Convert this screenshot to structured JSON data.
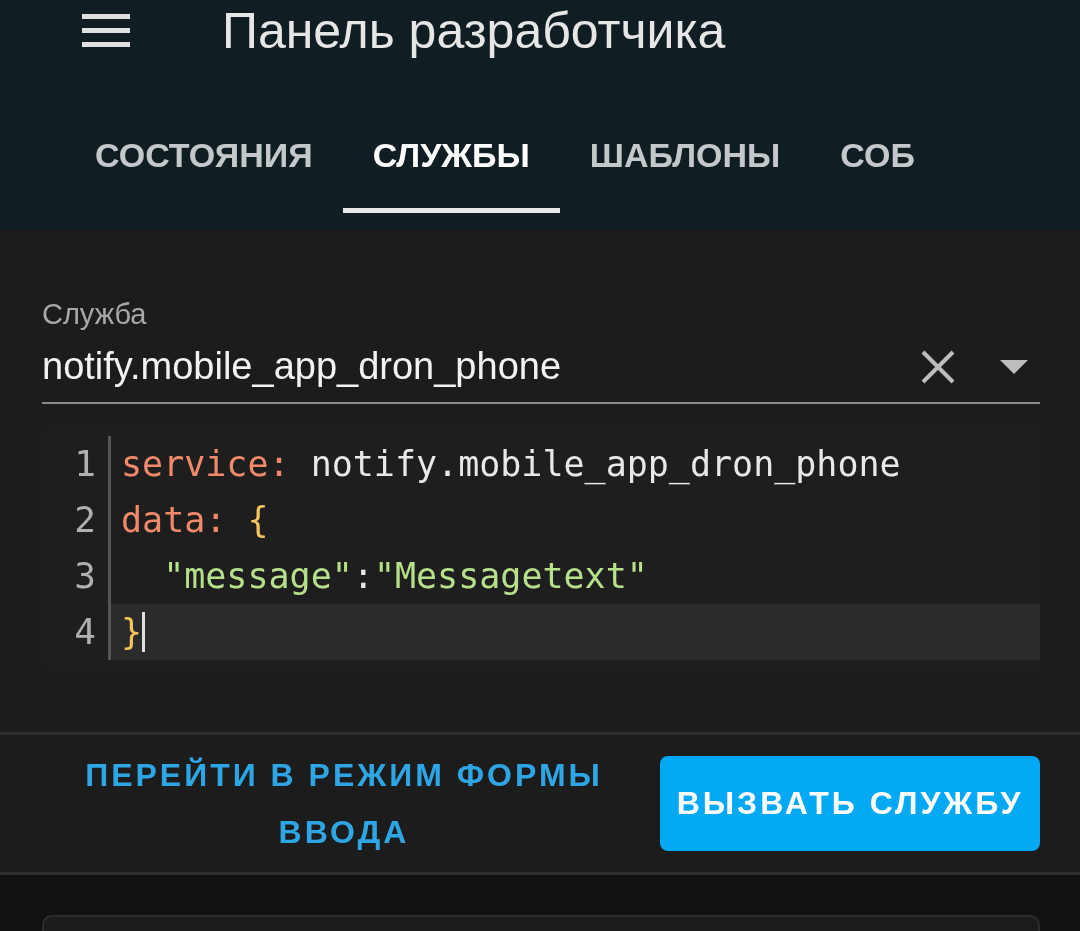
{
  "header": {
    "title": "Панель разработчика"
  },
  "tabs": [
    {
      "label": "СОСТОЯНИЯ",
      "selected": false
    },
    {
      "label": "СЛУЖБЫ",
      "selected": true
    },
    {
      "label": "ШАБЛОНЫ",
      "selected": false
    },
    {
      "label": "СОБ",
      "selected": false
    }
  ],
  "service_field": {
    "label": "Служба",
    "value": "notify.mobile_app_dron_phone"
  },
  "editor": {
    "lines": [
      {
        "number": "1",
        "active": false,
        "tokens": [
          {
            "kind": "key",
            "text": "service:"
          },
          {
            "kind": "plain",
            "text": " notify.mobile_app_dron_phone"
          }
        ]
      },
      {
        "number": "2",
        "active": false,
        "tokens": [
          {
            "kind": "key",
            "text": "data:"
          },
          {
            "kind": "brace",
            "text": " {"
          }
        ]
      },
      {
        "number": "3",
        "active": false,
        "tokens": [
          {
            "kind": "string",
            "text": "  \"message\""
          },
          {
            "kind": "plain",
            "text": ":"
          },
          {
            "kind": "string",
            "text": "\"Messagetext\""
          }
        ]
      },
      {
        "number": "4",
        "active": true,
        "tokens": [
          {
            "kind": "brace",
            "text": "}"
          }
        ]
      }
    ]
  },
  "actions": [
    {
      "kind": "text",
      "label": "ПЕРЕЙТИ В РЕЖИМ ФОРМЫ ВВОДА"
    },
    {
      "kind": "filled",
      "label": "ВЫЗВАТЬ СЛУЖБУ"
    }
  ]
}
